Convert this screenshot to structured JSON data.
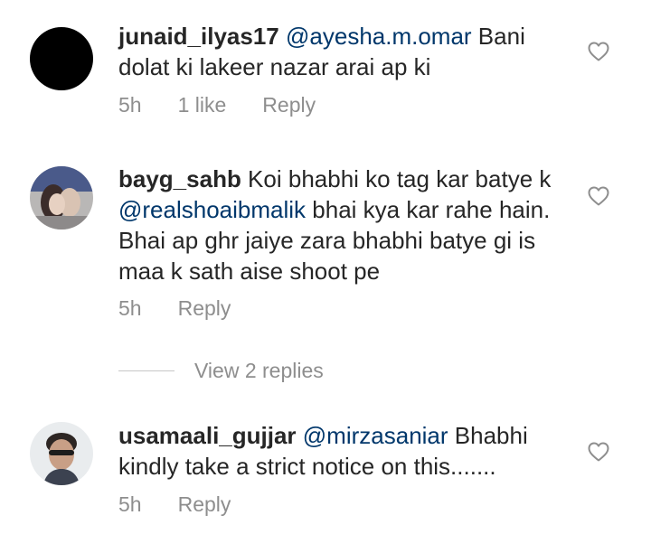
{
  "comments": [
    {
      "username": "junaid_ilyas17",
      "mention": "@ayesha.m.omar",
      "text_after": " Bani dolat ki lakeer nazar arai ap ki",
      "time": "5h",
      "likes": "1 like",
      "reply": "Reply",
      "avatar_color": "#000000"
    },
    {
      "username": "bayg_sahb",
      "text_before": " Koi bhabhi ko tag kar batye k ",
      "mention": "@realshoaibmalik",
      "text_after": " bhai kya kar rahe hain. Bhai ap ghr jaiye zara bhabhi batye gi is maa k sath aise shoot pe",
      "time": "5h",
      "reply": "Reply",
      "view_replies": "View 2 replies"
    },
    {
      "username": "usamaali_gujjar",
      "mention": "@mirzasaniar",
      "text_after": " Bhabhi kindly take a strict notice on this.......",
      "time": "5h",
      "reply": "Reply"
    }
  ],
  "icons": {
    "like": "heart-outline-icon"
  },
  "colors": {
    "mention": "#00376b",
    "meta": "#8e8e8e",
    "text": "#262626"
  }
}
